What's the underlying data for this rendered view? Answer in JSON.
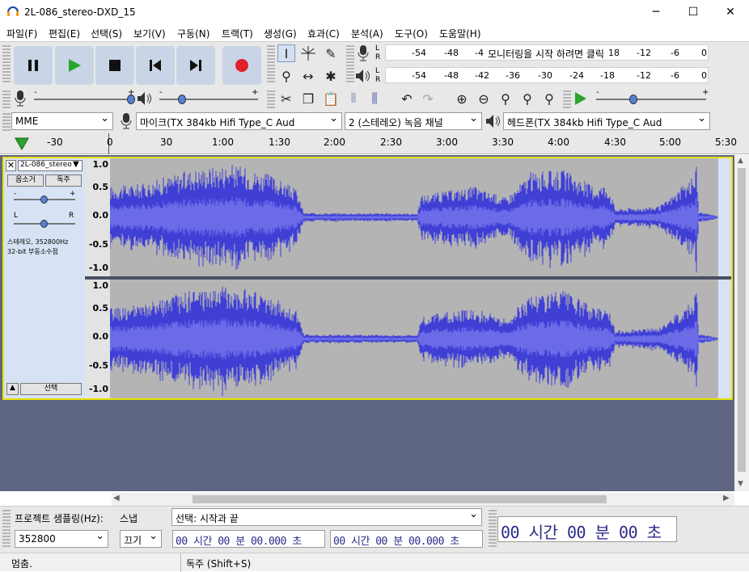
{
  "window": {
    "title": "2L-086_stereo-DXD_15",
    "minimize": "─",
    "maximize": "☐",
    "close": "✕"
  },
  "menu": [
    "파일(F)",
    "편집(E)",
    "선택(S)",
    "보기(V)",
    "구동(N)",
    "트랙(T)",
    "생성(G)",
    "효과(C)",
    "분석(A)",
    "도구(O)",
    "도움말(H)"
  ],
  "meter": {
    "record_scale": [
      "-54",
      "-48",
      "-4"
    ],
    "record_prompt": "모니터링을 시작 하려면 클릭",
    "record_scale2": [
      "18",
      "-12",
      "-6",
      "0"
    ],
    "play_scale": [
      "-54",
      "-48",
      "-42",
      "-36",
      "-30",
      "-24",
      "-18",
      "-12",
      "-6",
      "0"
    ],
    "L": "L",
    "R": "R"
  },
  "devices": {
    "host": "MME",
    "mic": "마이크(TX 384kb Hifi Type_C Aud",
    "channels": "2 (스테레오) 녹음 채널",
    "speaker": "헤드폰(TX 384kb Hifi Type_C Aud"
  },
  "ruler": [
    "-30",
    "0",
    "30",
    "1:00",
    "1:30",
    "2:00",
    "2:30",
    "3:00",
    "3:30",
    "4:00",
    "4:30",
    "5:00",
    "5:30"
  ],
  "track": {
    "name": "2L-086_stereo",
    "mute": "음소거",
    "solo": "독주",
    "gain_minus": "-",
    "gain_plus": "+",
    "pan_left": "L",
    "pan_right": "R",
    "info_line1": "스테레오, 352800Hz",
    "info_line2": "32-bit 부동소수점",
    "select": "선택",
    "scale": [
      "1.0",
      "0.5",
      "0.0",
      "-0.5",
      "-1.0"
    ]
  },
  "bottom": {
    "rate_label": "프로젝트 샘플링(Hz):",
    "rate_value": "352800",
    "snap_label": "스냅",
    "snap_value": "끄기",
    "selection_mode": "선택: 시작과 끝",
    "start_time": "00 시간 00 분 00.000 초",
    "end_time": "00 시간 00 분 00.000 초",
    "big_time": "00 시간 00 분 00 초"
  },
  "status": {
    "left": "멈춤.",
    "right": "독주 (Shift+S)"
  },
  "colors": {
    "waveform": "#3f3fd6",
    "rms": "#6b6be8",
    "selection_border": "#e9e400",
    "background": "#5f6682"
  }
}
